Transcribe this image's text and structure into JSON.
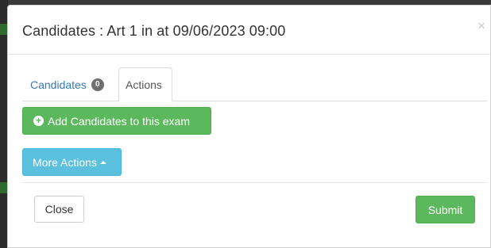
{
  "modal": {
    "title": "Candidates : Art 1 in at 09/06/2023 09:00",
    "close_symbol": "×"
  },
  "tabs": [
    {
      "label": "Candidates",
      "badge": "0",
      "active": false
    },
    {
      "label": "Actions",
      "active": true
    }
  ],
  "actions": {
    "add_candidates_label": "Add Candidates to this exam",
    "add_icon": "plus-circle-icon",
    "more_actions_label": "More Actions",
    "more_icon": "caret-up-icon"
  },
  "footer": {
    "close_label": "Close",
    "submit_label": "Submit"
  },
  "colors": {
    "success": "#5cb85c",
    "info": "#5bc0de",
    "link": "#337ab7"
  }
}
